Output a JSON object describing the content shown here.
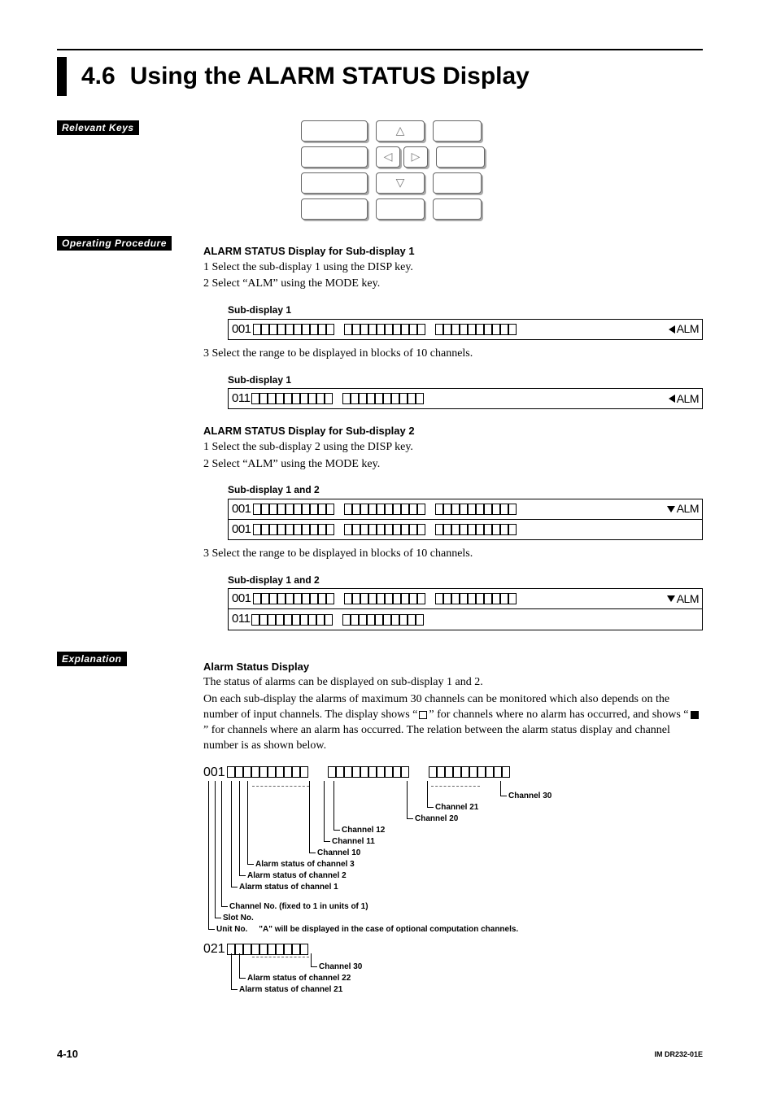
{
  "title": {
    "number": "4.6",
    "text": "Using the ALARM STATUS Display"
  },
  "sections": {
    "relevant_keys": "Relevant Keys",
    "operating_procedure": "Operating Procedure",
    "explanation": "Explanation"
  },
  "proc1": {
    "heading": "ALARM STATUS Display for Sub-display 1",
    "step1": "1  Select the sub-display 1 using the DISP key.",
    "step2": "2  Select “ALM” using the MODE key.",
    "disp1_label": "Sub-display 1",
    "disp1_num": "001",
    "disp1_mode": "ALM",
    "step3": "3  Select the range to be displayed in blocks of 10 channels.",
    "disp2_label": "Sub-display 1",
    "disp2_num": "011",
    "disp2_mode": "ALM"
  },
  "proc2": {
    "heading": "ALARM STATUS Display for Sub-display 2",
    "step1": "1  Select the sub-display 2 using the DISP key.",
    "step2": "2  Select “ALM” using the MODE key.",
    "disp_label": "Sub-display 1 and 2",
    "row1_num": "001",
    "row1_mode": "ALM",
    "row2_num": "001",
    "step3": "3  Select the range to be displayed in blocks of 10 channels.",
    "disp2_label": "Sub-display 1 and 2",
    "r2_row1_num": "001",
    "r2_row1_mode": "ALM",
    "r2_row2_num": "011"
  },
  "explanation": {
    "heading": "Alarm Status Display",
    "p1": "The status of alarms can be displayed on sub-display 1 and 2.",
    "p2a": "On each sub-display the alarms of maximum 30 channels can be monitored which also depends on the number of input channels. The display shows “",
    "p2b": "” for channels where no alarm has occurred, and shows “",
    "p2c": "” for channels where an alarm has occurred. The relation between the alarm status display and channel number is as shown below."
  },
  "diagram": {
    "row1_num": "001",
    "row2_num": "021",
    "ch30": "Channel 30",
    "ch21": "Channel 21",
    "ch20": "Channel 20",
    "ch12": "Channel 12",
    "ch11": "Channel 11",
    "ch10": "Channel 10",
    "as3": "Alarm status of channel 3",
    "as2": "Alarm status of channel 2",
    "as1": "Alarm status of channel 1",
    "chno": "Channel No. (fixed to 1 in units of 1)",
    "slot": "Slot No.",
    "unit": "Unit No.",
    "unit_note": "\"A\" will be displayed in the case of optional computation channels.",
    "b_ch30": "Channel 30",
    "b_as22": "Alarm status of channel 22",
    "b_as21": "Alarm status of channel 21"
  },
  "footer": {
    "page": "4-10",
    "docid": "IM DR232-01E"
  }
}
